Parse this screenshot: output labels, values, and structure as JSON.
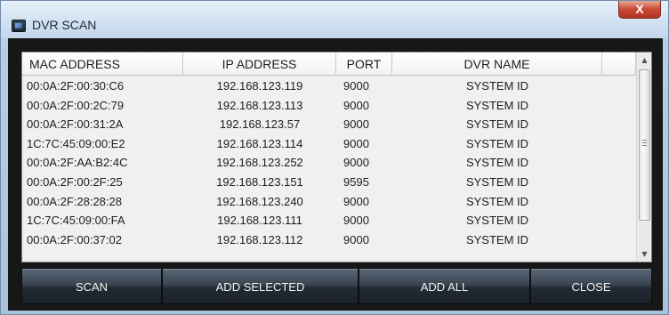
{
  "window": {
    "title": "DVR SCAN",
    "close_glyph": "X"
  },
  "table": {
    "columns": [
      "MAC ADDRESS",
      "IP ADDRESS",
      "PORT",
      "DVR NAME"
    ],
    "rows": [
      {
        "mac": "00:0A:2F:00:30:C6",
        "ip": "192.168.123.119",
        "port": "9000",
        "name": "SYSTEM ID"
      },
      {
        "mac": "00:0A:2F:00:2C:79",
        "ip": "192.168.123.113",
        "port": "9000",
        "name": "SYSTEM ID"
      },
      {
        "mac": "00:0A:2F:00:31:2A",
        "ip": "192.168.123.57",
        "port": "9000",
        "name": "SYSTEM ID"
      },
      {
        "mac": "1C:7C:45:09:00:E2",
        "ip": "192.168.123.114",
        "port": "9000",
        "name": "SYSTEM ID"
      },
      {
        "mac": "00:0A:2F:AA:B2:4C",
        "ip": "192.168.123.252",
        "port": "9000",
        "name": "SYSTEM ID"
      },
      {
        "mac": "00:0A:2F:00:2F:25",
        "ip": "192.168.123.151",
        "port": "9595",
        "name": "SYSTEM ID"
      },
      {
        "mac": "00:0A:2F:28:28:28",
        "ip": "192.168.123.240",
        "port": "9000",
        "name": "SYSTEM ID"
      },
      {
        "mac": "1C:7C:45:09:00:FA",
        "ip": "192.168.123.111",
        "port": "9000",
        "name": "SYSTEM ID"
      },
      {
        "mac": "00:0A:2F:00:37:02",
        "ip": "192.168.123.112",
        "port": "9000",
        "name": "SYSTEM ID"
      }
    ]
  },
  "buttons": {
    "scan": "SCAN",
    "add_selected": "ADD SELECTED",
    "add_all": "ADD ALL",
    "close": "CLOSE"
  },
  "icons": {
    "app": "dvr-app-icon",
    "scroll_up": "chevron-up-icon",
    "scroll_down": "chevron-down-icon"
  },
  "colors": {
    "client_background": "#171717",
    "button_dark": "#222a33",
    "close_red": "#c74a34"
  }
}
